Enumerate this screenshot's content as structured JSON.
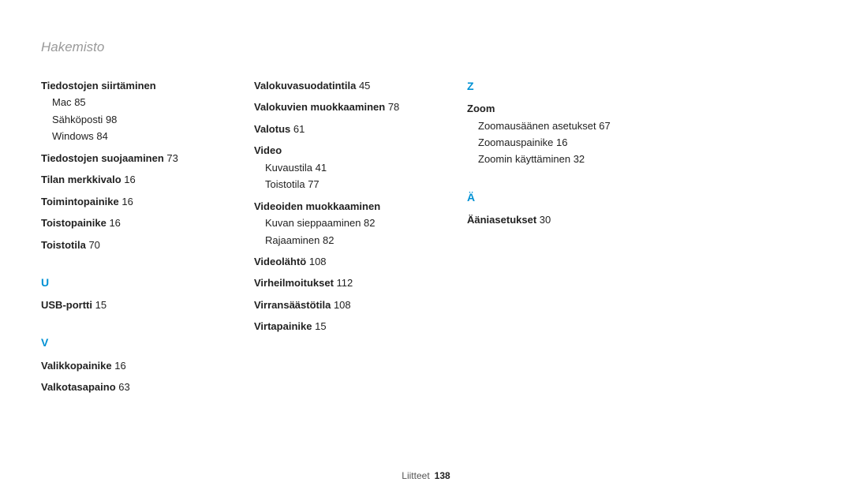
{
  "header": {
    "title": "Hakemisto"
  },
  "footer": {
    "section": "Liitteet",
    "page": "138"
  },
  "col1": {
    "tiedostojen_siirtaminen": "Tiedostojen siirtäminen",
    "mac": "Mac",
    "mac_p": "85",
    "sahkoposti": "Sähköposti",
    "sahkoposti_p": "98",
    "windows": "Windows",
    "windows_p": "84",
    "tiedostojen_suojaaminen": "Tiedostojen suojaaminen",
    "tiedostojen_suojaaminen_p": "73",
    "tilan_merkkivalo": "Tilan merkkivalo",
    "tilan_merkkivalo_p": "16",
    "toimintopainike": "Toimintopainike",
    "toimintopainike_p": "16",
    "toistopainike": "Toistopainike",
    "toistopainike_p": "16",
    "toistotila": "Toistotila",
    "toistotila_p": "70",
    "letter_u": "U",
    "usb_portti": "USB-portti",
    "usb_portti_p": "15",
    "letter_v": "V",
    "valikkopainike": "Valikkopainike",
    "valikkopainike_p": "16",
    "valkotasapaino": "Valkotasapaino",
    "valkotasapaino_p": "63"
  },
  "col2": {
    "valokuvasuodatintila": "Valokuvasuodatintila",
    "valokuvasuodatintila_p": "45",
    "valokuvien_muokkaaminen": "Valokuvien muokkaaminen",
    "valokuvien_muokkaaminen_p": "78",
    "valotus": "Valotus",
    "valotus_p": "61",
    "video": "Video",
    "kuvaustila": "Kuvaustila",
    "kuvaustila_p": "41",
    "toistotila": "Toistotila",
    "toistotila_p": "77",
    "videoiden_muokkaaminen": "Videoiden muokkaaminen",
    "kuvan_sieppaaminen": "Kuvan sieppaaminen",
    "kuvan_sieppaaminen_p": "82",
    "rajaaminen": "Rajaaminen",
    "rajaaminen_p": "82",
    "videolahto": "Videolähtö",
    "videolahto_p": "108",
    "virheilmoitukset": "Virheilmoitukset",
    "virheilmoitukset_p": "112",
    "virransaastotila": "Virransäästötila",
    "virransaastotila_p": "108",
    "virtapainike": "Virtapainike",
    "virtapainike_p": "15"
  },
  "col3": {
    "letter_z": "Z",
    "zoom": "Zoom",
    "zoomausaanen_asetukset": "Zoomausäänen asetukset",
    "zoomausaanen_asetukset_p": "67",
    "zoomauspainike": "Zoomauspainike",
    "zoomauspainike_p": "16",
    "zoomin_kayttaminen": "Zoomin käyttäminen",
    "zoomin_kayttaminen_p": "32",
    "letter_a": "Ä",
    "aaniasetukset": "Ääniasetukset",
    "aaniasetukset_p": "30"
  }
}
